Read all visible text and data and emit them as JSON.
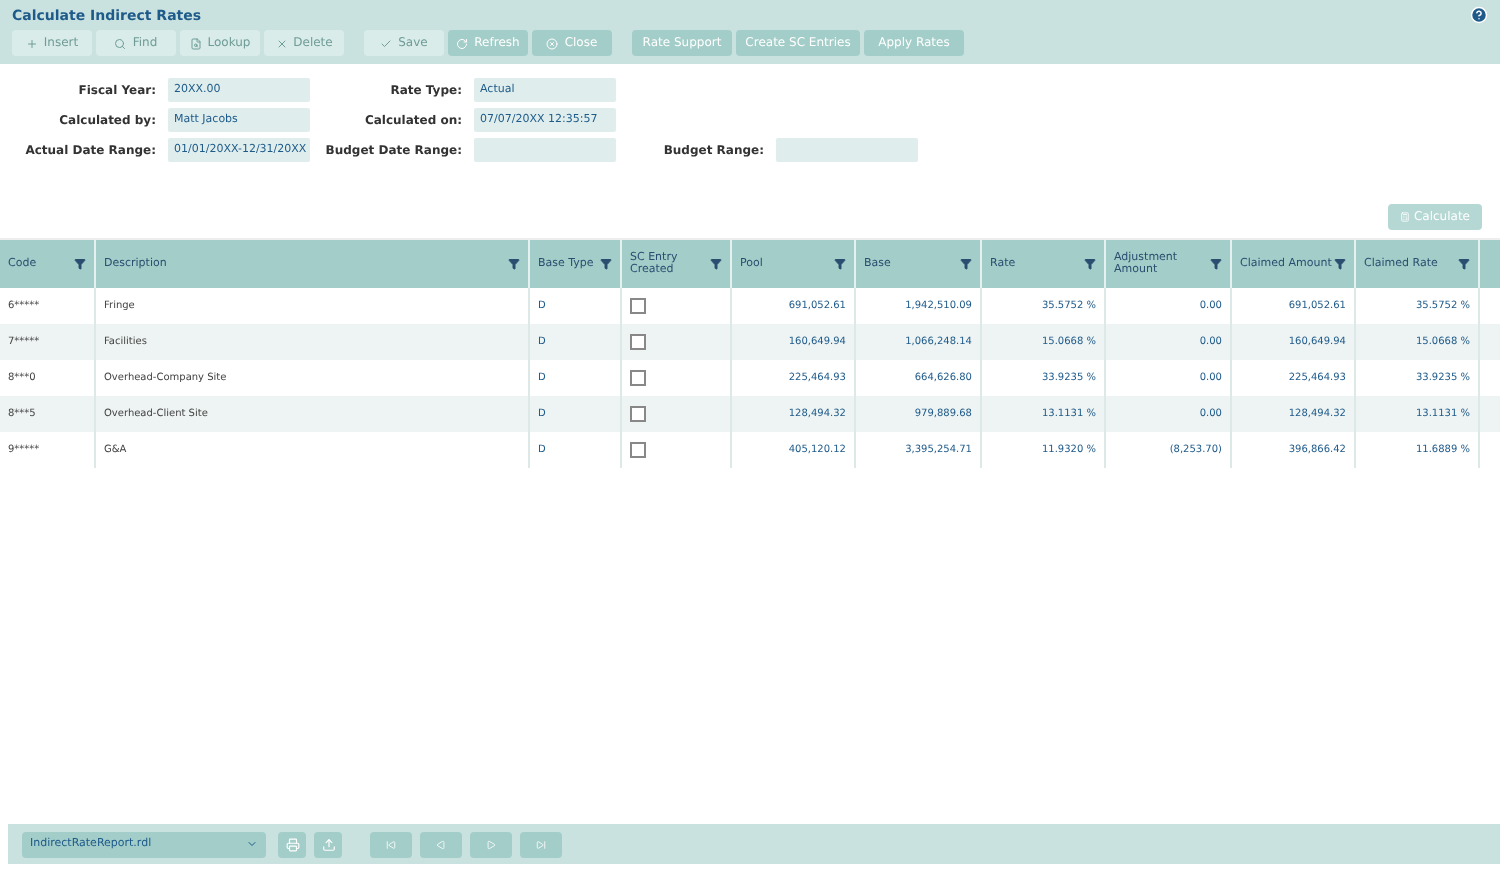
{
  "title": "Calculate Indirect Rates",
  "toolbar": [
    {
      "label": "Insert",
      "disabled": true
    },
    {
      "label": "Find",
      "disabled": true
    },
    {
      "label": "Lookup",
      "disabled": true
    },
    {
      "label": "Delete",
      "disabled": true
    },
    {
      "label": "Save",
      "disabled": true
    },
    {
      "label": "Refresh",
      "disabled": false
    },
    {
      "label": "Close",
      "disabled": false
    },
    {
      "label": "Rate Support",
      "disabled": false
    },
    {
      "label": "Create SC Entries",
      "disabled": false
    },
    {
      "label": "Apply Rates",
      "disabled": false
    }
  ],
  "form": [
    [
      {
        "label": "Fiscal Year:",
        "value": "20XX.00"
      },
      {
        "label": "Rate Type:",
        "value": "Actual"
      }
    ],
    [
      {
        "label": "Calculated by:",
        "value": "Matt Jacobs"
      },
      {
        "label": "Calculated on:",
        "value": "07/07/20XX  12:35:57"
      }
    ],
    [
      {
        "label": "Actual Date Range:",
        "value": "01/01/20XX-12/31/20XX"
      },
      {
        "label": "Budget Date Range:"
      },
      {
        "label": "Budget Range:"
      }
    ]
  ],
  "calculate_button": {
    "label": "Calculate",
    "disabled": true
  },
  "table": {
    "columns": [
      "Code",
      "Description",
      "Base Type",
      "SC Entry Created",
      "Pool",
      "Base",
      "Rate",
      "Adjustment Amount",
      "Claimed Amount",
      "Claimed Rate"
    ],
    "rows": [
      {
        "cells": [
          "6*****",
          "Fringe",
          "D",
          false,
          "691,052.61",
          "1,942,510.09",
          "35.5752 %",
          "0.00",
          "691,052.61",
          "35.5752 %"
        ]
      },
      {
        "cells": [
          "7*****",
          "Facilities",
          "D",
          false,
          "160,649.94",
          "1,066,248.14",
          "15.0668 %",
          "0.00",
          "160,649.94",
          "15.0668 %"
        ]
      },
      {
        "cells": [
          "8***0",
          "Overhead-Company Site",
          "D",
          false,
          "225,464.93",
          "664,626.80",
          "33.9235 %",
          "0.00",
          "225,464.93",
          "33.9235 %"
        ]
      },
      {
        "cells": [
          "8***5",
          "Overhead-Client Site",
          "D",
          false,
          "128,494.32",
          "979,889.68",
          "13.1131 %",
          "0.00",
          "128,494.32",
          "13.1131 %"
        ]
      },
      {
        "cells": [
          "9*****",
          "G&A",
          "D",
          false,
          "405,120.12",
          "3,395,254.71",
          "11.9320 %",
          "(8,253.70)",
          "396,866.42",
          "11.6889 %"
        ]
      }
    ]
  },
  "report_select": {
    "value": "IndirectRateReport.rdl"
  }
}
